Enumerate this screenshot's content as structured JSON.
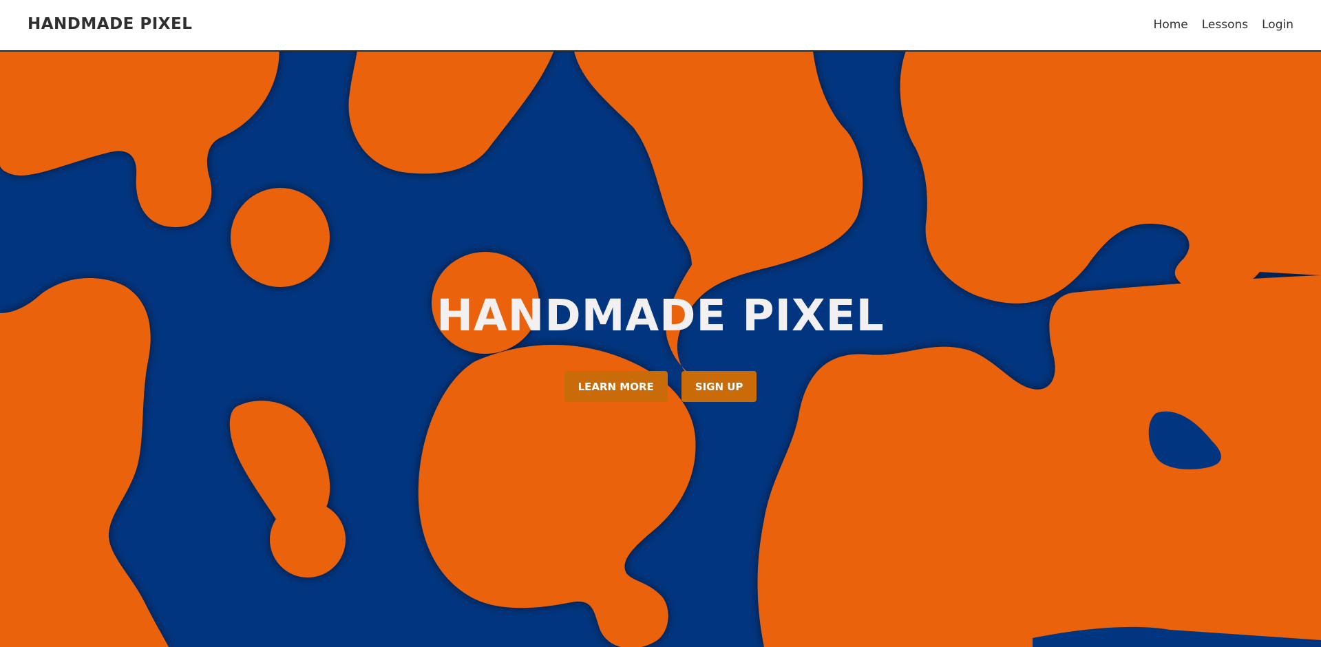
{
  "nav": {
    "brand": "HANDMADE PIXEL",
    "links": [
      {
        "label": "Home"
      },
      {
        "label": "Lessons"
      },
      {
        "label": "Login"
      }
    ]
  },
  "hero": {
    "title": "HANDMADE PIXEL",
    "buttons": {
      "learn_more": "LEARN MORE",
      "sign_up": "SIGN UP"
    }
  },
  "colors": {
    "background_blue": "#02357f",
    "blob_orange": "#eb620b",
    "button_orange": "#c86b08",
    "title_text": "#f2f0f0",
    "nav_text": "#2f2f2f"
  }
}
